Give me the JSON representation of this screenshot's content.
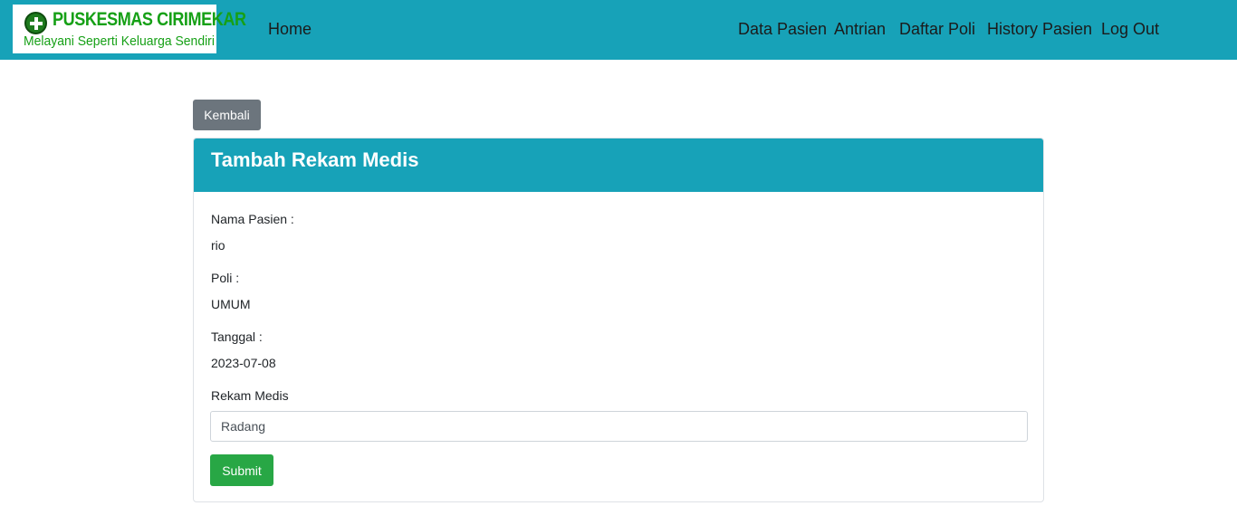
{
  "navbar": {
    "logo": {
      "title": "PUSKESMAS CIRIMEKAR",
      "tagline": "Melayani Seperti Keluarga Sendiri"
    },
    "home_label": "Home",
    "links": [
      "Data Pasien",
      "Antrian",
      "Daftar Poli",
      "History Pasien",
      "Log Out"
    ]
  },
  "back_button_label": "Kembali",
  "form": {
    "title": "Tambah Rekam Medis",
    "nama_label": "Nama Pasien :",
    "nama_value": "rio",
    "poli_label": "Poli :",
    "poli_value": "UMUM",
    "tanggal_label": "Tanggal :",
    "tanggal_value": "2023-07-08",
    "rekam_label": "Rekam Medis",
    "rekam_value": "Radang",
    "submit_label": "Submit"
  },
  "colors": {
    "primary": "#17a2b8",
    "secondary_button": "#6c757d",
    "success_button": "#28a745",
    "logo_text": "#16a016"
  }
}
